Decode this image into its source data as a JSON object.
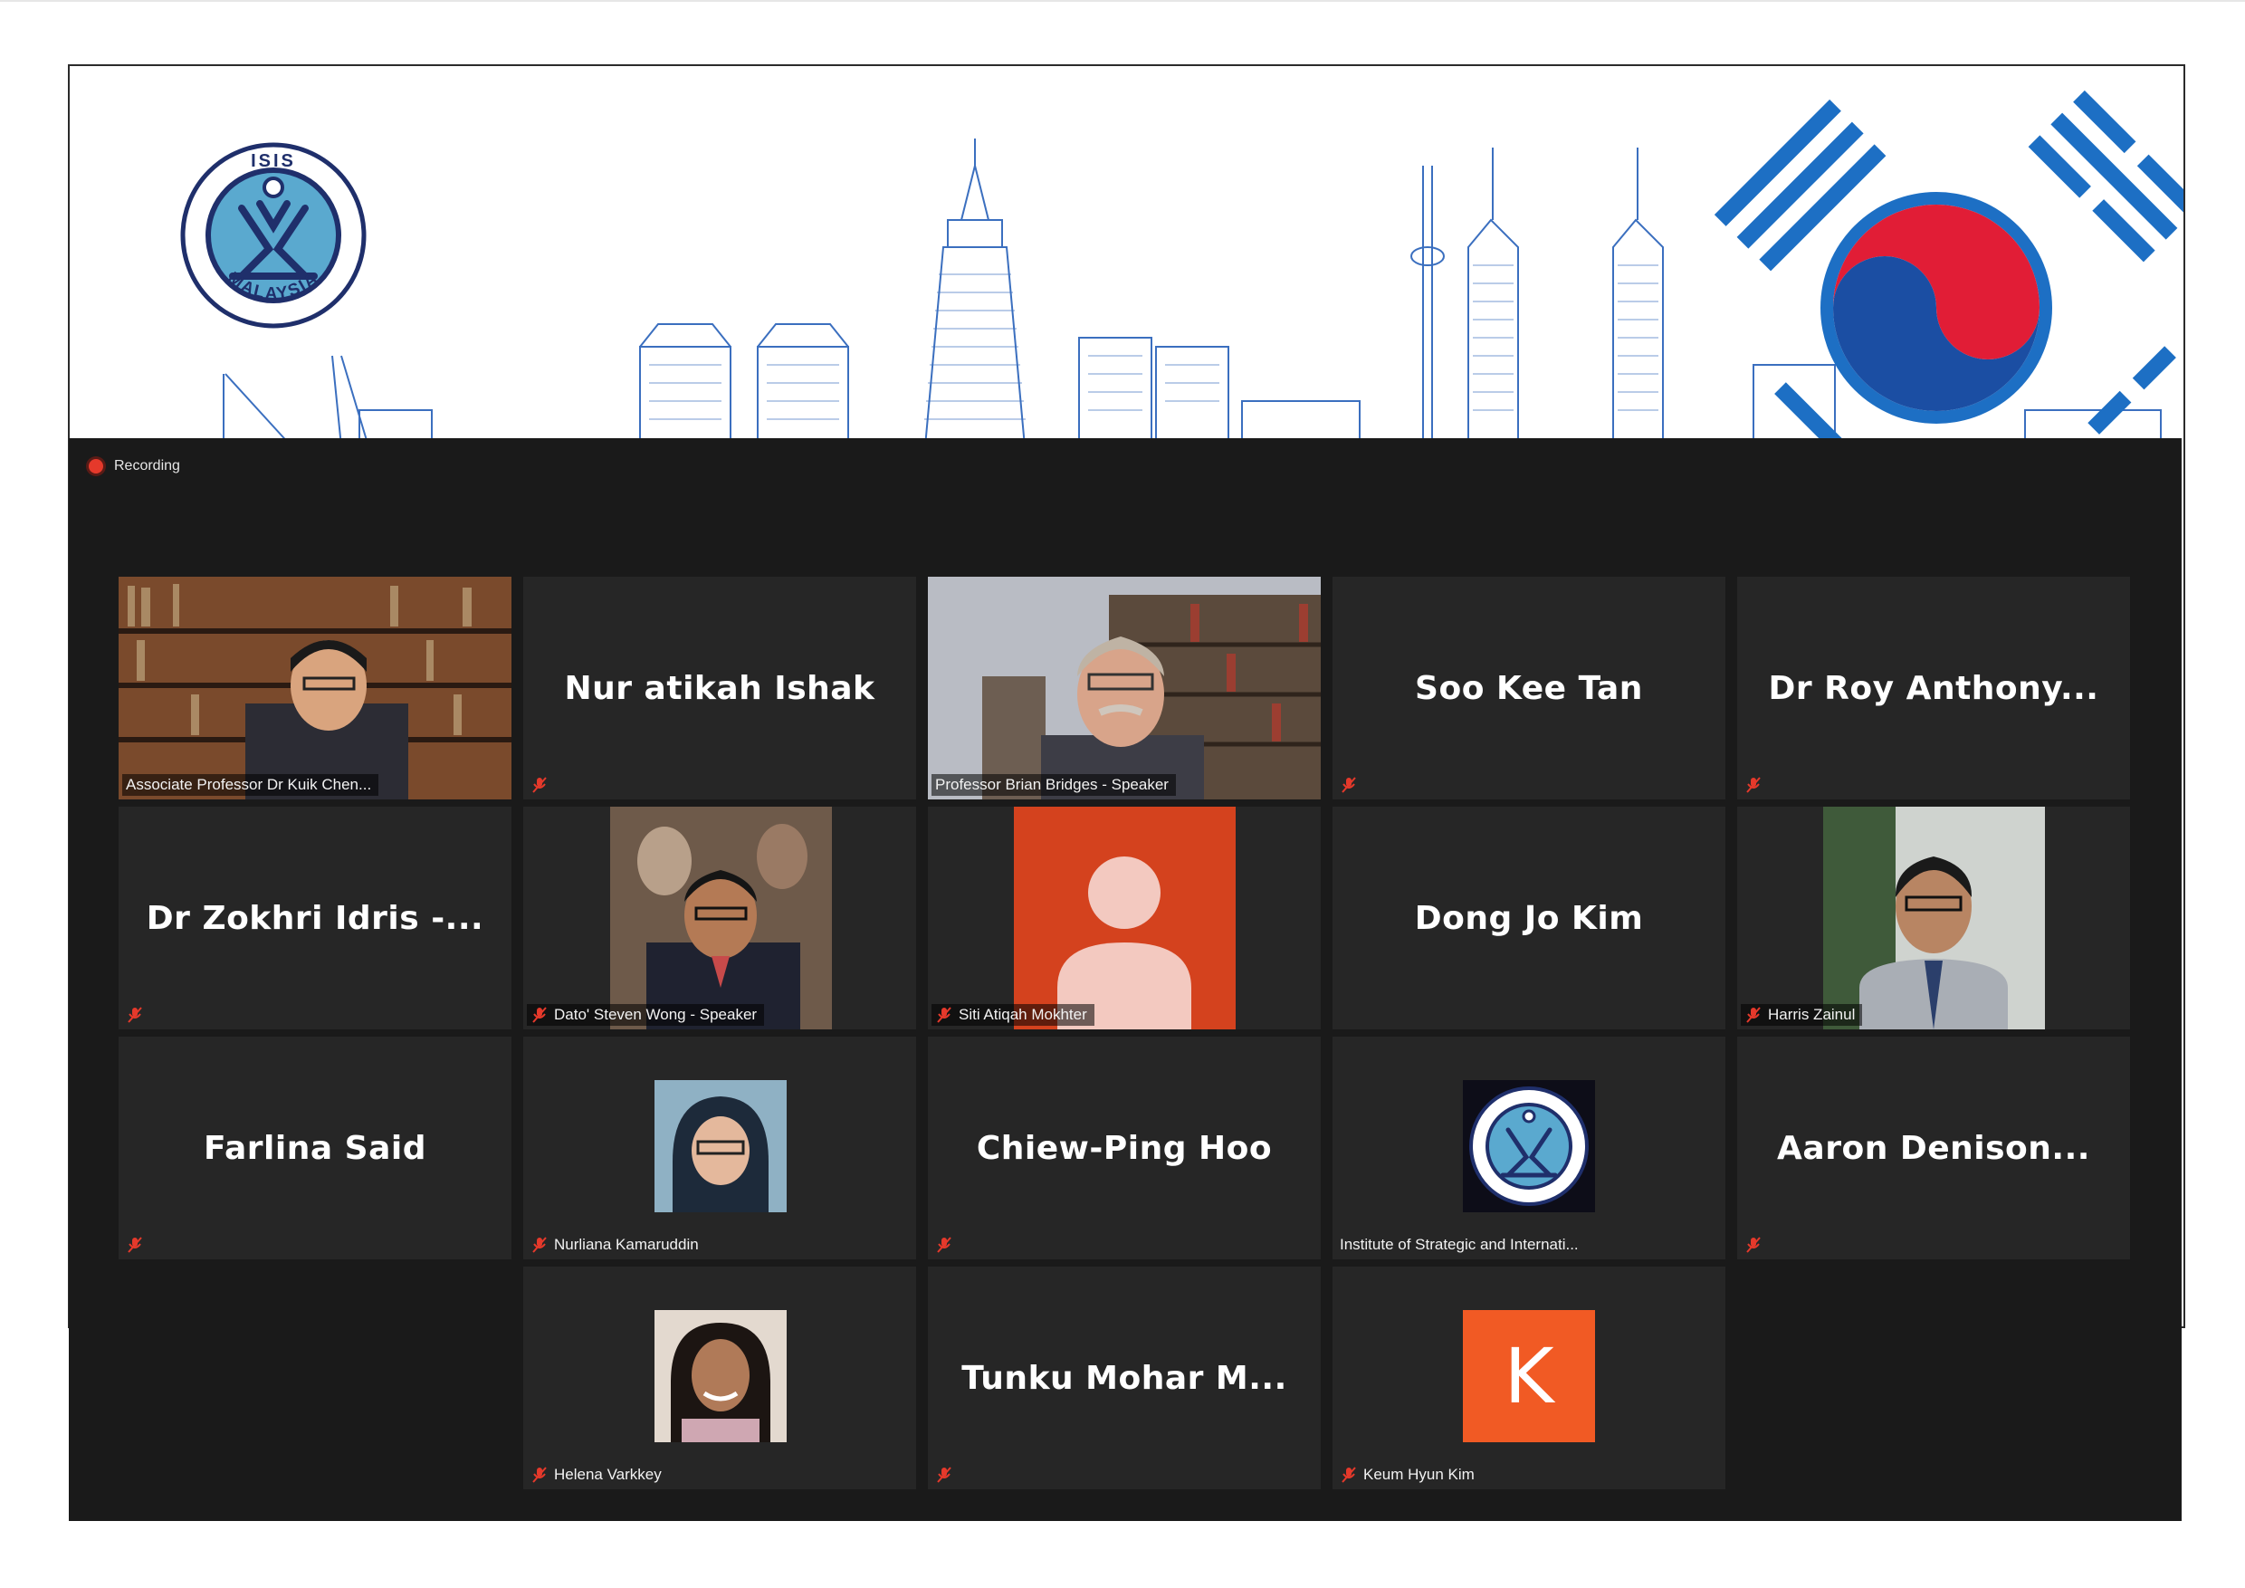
{
  "banner": {
    "logo_top": "ISIS",
    "logo_bottom": "MALAYSIA"
  },
  "meeting": {
    "recording_label": "Recording",
    "colors": {
      "active_speaker": "#b5e03c",
      "tile_bg": "#262626",
      "window_bg": "#1a1a1a"
    },
    "tiles": [
      {
        "name": "Associate Professor Dr Kuik Chen...",
        "type": "video",
        "muted": false
      },
      {
        "name": "Nur atikah Ishak",
        "type": "name",
        "muted": true
      },
      {
        "name": "Professor Brian Bridges - Speaker",
        "type": "video",
        "muted": false,
        "active": true
      },
      {
        "name": "Soo Kee Tan",
        "type": "name",
        "muted": true
      },
      {
        "name": "Dr Roy Anthony...",
        "type": "name",
        "muted": true
      },
      {
        "name": "Dr Zokhri Idris -...",
        "type": "name",
        "muted": true
      },
      {
        "name": "Dato' Steven Wong - Speaker",
        "type": "photo",
        "muted": true
      },
      {
        "name": "Siti Atiqah Mokhter",
        "type": "avatar",
        "muted": true
      },
      {
        "name": "Dong Jo Kim",
        "type": "name",
        "muted": false
      },
      {
        "name": "Harris Zainul",
        "type": "photo",
        "muted": true
      },
      {
        "name": "Farlina Said",
        "type": "name",
        "muted": true
      },
      {
        "name": "Nurliana Kamaruddin",
        "type": "photo",
        "muted": true
      },
      {
        "name": "Chiew-Ping Hoo",
        "type": "name",
        "muted": true
      },
      {
        "name": "Institute of Strategic and Internati...",
        "type": "logo",
        "muted": false
      },
      {
        "name": "Aaron Denison...",
        "type": "name",
        "muted": true
      },
      {
        "name": "Helena Varkkey",
        "type": "photo",
        "muted": true
      },
      {
        "name": "Tunku Mohar M...",
        "type": "name",
        "muted": true
      },
      {
        "name": "Keum Hyun Kim",
        "type": "letter",
        "letter": "K",
        "muted": true
      }
    ]
  }
}
